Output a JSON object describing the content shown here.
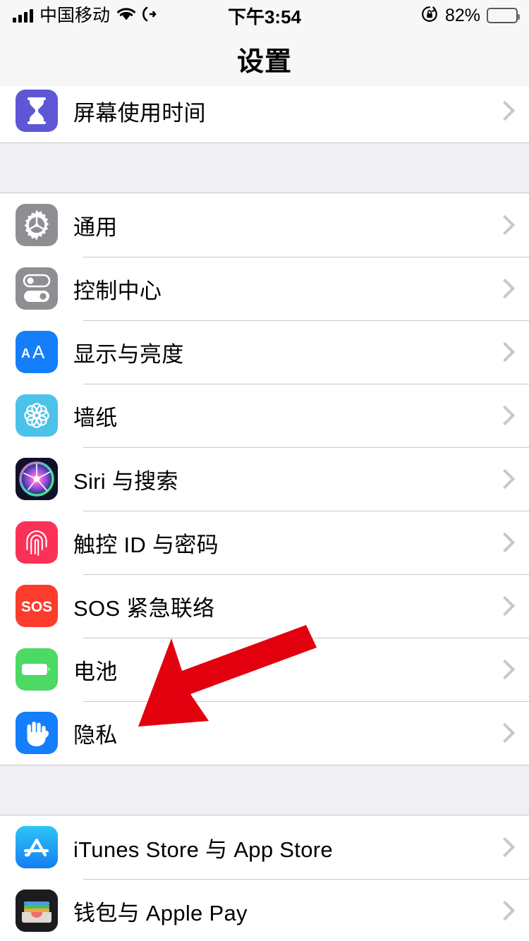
{
  "status_bar": {
    "carrier": "中国移动",
    "signal_icon": "cellular-signal-icon",
    "wifi_icon": "wifi-icon",
    "location_icon": "location-arrow-icon",
    "time": "下午3:54",
    "rotation_lock_icon": "rotation-lock-icon",
    "battery_percent": "82%",
    "battery_level": 82,
    "battery_icon": "battery-icon"
  },
  "nav": {
    "title": "设置"
  },
  "colors": {
    "background": "#efeff4",
    "row_background": "#ffffff",
    "separator": "#c8c7cc",
    "chevron": "#c7c7cc",
    "arrow": "#e2000f"
  },
  "sections": [
    {
      "name": "screen-time-group",
      "rows": [
        {
          "label": "屏幕使用时间",
          "icon": "hourglass-icon",
          "icon_color": "#5d57d6",
          "chevron": true
        }
      ]
    },
    {
      "name": "system-group",
      "rows": [
        {
          "label": "通用",
          "icon": "gear-icon",
          "icon_color": "#8e8e93",
          "chevron": true
        },
        {
          "label": "控制中心",
          "icon": "toggles-icon",
          "icon_color": "#8e8e93",
          "chevron": true
        },
        {
          "label": "显示与亮度",
          "icon": "aa-text-icon",
          "icon_color": "#147efb",
          "chevron": true
        },
        {
          "label": "墙纸",
          "icon": "flower-icon",
          "icon_color": "#4cc2ea",
          "chevron": true
        },
        {
          "label": "Siri 与搜索",
          "icon": "siri-orb-icon",
          "icon_color": "#1a1a2e",
          "chevron": true
        },
        {
          "label": "触控 ID 与密码",
          "icon": "fingerprint-icon",
          "icon_color": "#fc3158",
          "chevron": true
        },
        {
          "label": "SOS 紧急联络",
          "icon": "sos-icon",
          "icon_color": "#fc3c2d",
          "chevron": true
        },
        {
          "label": "电池",
          "icon": "battery-icon",
          "icon_color": "#4cd964",
          "chevron": true
        },
        {
          "label": "隐私",
          "icon": "hand-icon",
          "icon_color": "#147efb",
          "chevron": true
        }
      ]
    },
    {
      "name": "stores-group",
      "rows": [
        {
          "label": "iTunes Store 与 App Store",
          "icon": "app-store-icon",
          "icon_color": "#2aa3f5",
          "chevron": true
        },
        {
          "label": "钱包与 Apple Pay",
          "icon": "wallet-icon",
          "icon_color": "#1c1c1e",
          "chevron": true
        }
      ]
    }
  ],
  "annotation": {
    "arrow_icon": "red-arrow-annotation",
    "points_at": "隐私",
    "color": "#e2000f"
  }
}
